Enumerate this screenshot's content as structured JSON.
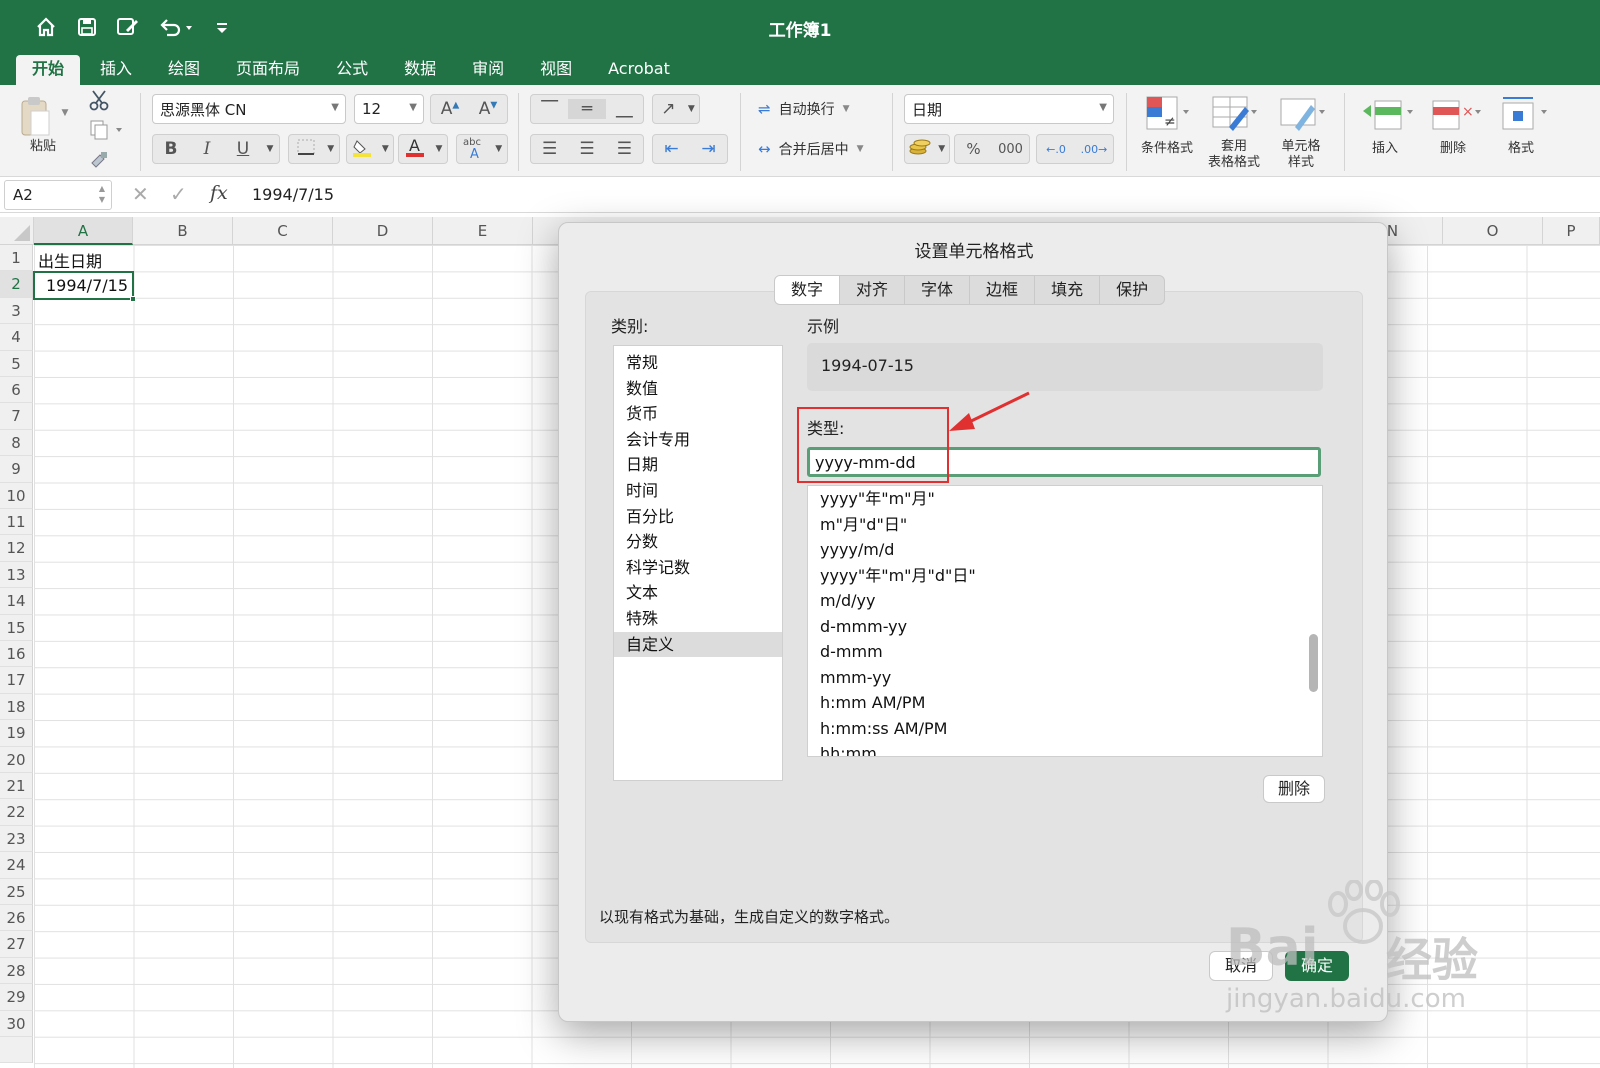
{
  "titlebar": {
    "title": "工作簿1"
  },
  "tabs": [
    "开始",
    "插入",
    "绘图",
    "页面布局",
    "公式",
    "数据",
    "审阅",
    "视图",
    "Acrobat"
  ],
  "ribbon": {
    "paste_label": "粘贴",
    "font_name": "思源黑体 CN",
    "font_size": "12",
    "wrap_text_label": "自动换行",
    "merge_center_label": "合并后居中",
    "number_format": "日期",
    "percent_label": "%",
    "thousands_label": "000",
    "cond_format_label": "条件格式",
    "table_format_label_1": "套用",
    "table_format_label_2": "表格格式",
    "cell_style_label_1": "单元格",
    "cell_style_label_2": "样式",
    "insert_label": "插入",
    "delete_label": "删除",
    "format_label": "格式"
  },
  "formula_bar": {
    "name_box": "A2",
    "fx_label": "fx",
    "value": "1994/7/15"
  },
  "grid": {
    "columns": [
      "A",
      "B",
      "C",
      "D",
      "E",
      "N",
      "O",
      "P"
    ],
    "rows": [
      "1",
      "2",
      "3",
      "4",
      "5",
      "6",
      "7",
      "8",
      "9",
      "10",
      "11",
      "12",
      "13",
      "14",
      "15",
      "16",
      "17",
      "18",
      "19",
      "20",
      "21",
      "22",
      "23",
      "24",
      "25",
      "26",
      "27",
      "28",
      "29",
      "30"
    ],
    "a1": "出生日期",
    "a2": "1994/7/15"
  },
  "dialog": {
    "title": "设置单元格格式",
    "tabs": [
      "数字",
      "对齐",
      "字体",
      "边框",
      "填充",
      "保护"
    ],
    "category_label": "类别:",
    "categories": [
      "常规",
      "数值",
      "货币",
      "会计专用",
      "日期",
      "时间",
      "百分比",
      "分数",
      "科学记数",
      "文本",
      "特殊",
      "自定义"
    ],
    "sample_label": "示例",
    "sample_value": "1994-07-15",
    "type_label": "类型:",
    "type_value": "yyyy-mm-dd",
    "formats": [
      "yyyy\"年\"m\"月\"",
      "m\"月\"d\"日\"",
      "yyyy/m/d",
      "yyyy\"年\"m\"月\"d\"日\"",
      "m/d/yy",
      "d-mmm-yy",
      "d-mmm",
      "mmm-yy",
      "h:mm AM/PM",
      "h:mm:ss AM/PM",
      "hh:mm"
    ],
    "delete_button": "删除",
    "description": "以现有格式为基础，生成自定义的数字格式。",
    "cancel_button": "取消",
    "ok_button": "确定"
  },
  "watermark": {
    "brand": "Bai",
    "brand_cn": "经验",
    "url": "jingyan.baidu.com"
  },
  "colors": {
    "accent": "#217346",
    "annotation": "#e03030",
    "input_focus": "#5a9e78"
  }
}
